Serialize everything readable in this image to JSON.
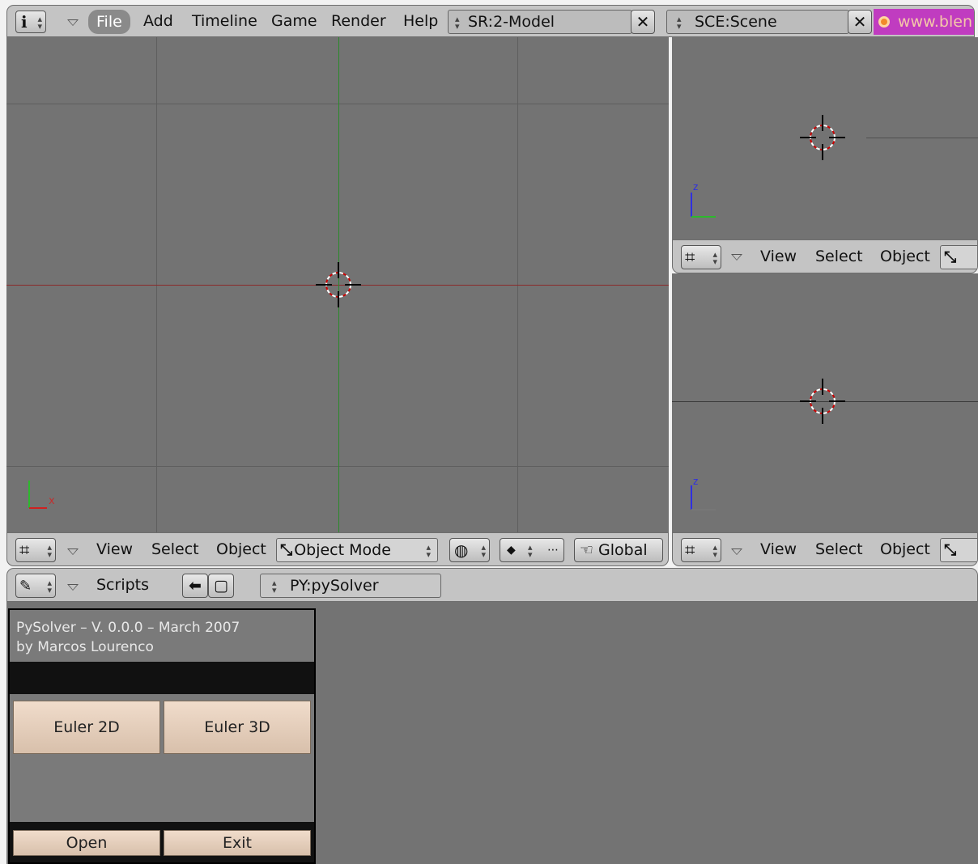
{
  "top_header": {
    "menus": [
      "File",
      "Add",
      "Timeline",
      "Game",
      "Render",
      "Help"
    ],
    "screen_field": "SR:2-Model",
    "scene_field": "SCE:Scene",
    "url_text": "www.blen"
  },
  "main_view": {
    "menus": [
      "View",
      "Select",
      "Object"
    ],
    "mode": "Object Mode",
    "orientation": "Global",
    "axis_x": "x"
  },
  "right_top_view": {
    "menus": [
      "View",
      "Select",
      "Object"
    ],
    "axis_z": "z"
  },
  "right_bottom_view": {
    "menus": [
      "View",
      "Select",
      "Object"
    ],
    "axis_z": "z"
  },
  "scripts_header": {
    "menu": "Scripts",
    "script_field": "PY:pySolver"
  },
  "pysolver": {
    "title_line1": "PySolver –  V. 0.0.0 – March 2007",
    "title_line2": "by Marcos Lourenco",
    "euler2d_label": "Euler 2D",
    "euler3d_label": "Euler 3D",
    "open_label": "Open",
    "exit_label": "Exit"
  },
  "colors": {
    "viewport_bg": "#737373",
    "grid_line": "#5e5e5e",
    "x_axis": "#8a2a2a",
    "y_axis": "#2a8a2a",
    "header_bg": "#c4c4c4",
    "button_fill": "#e6d2c0",
    "logo_bg": "#c03cc0"
  }
}
